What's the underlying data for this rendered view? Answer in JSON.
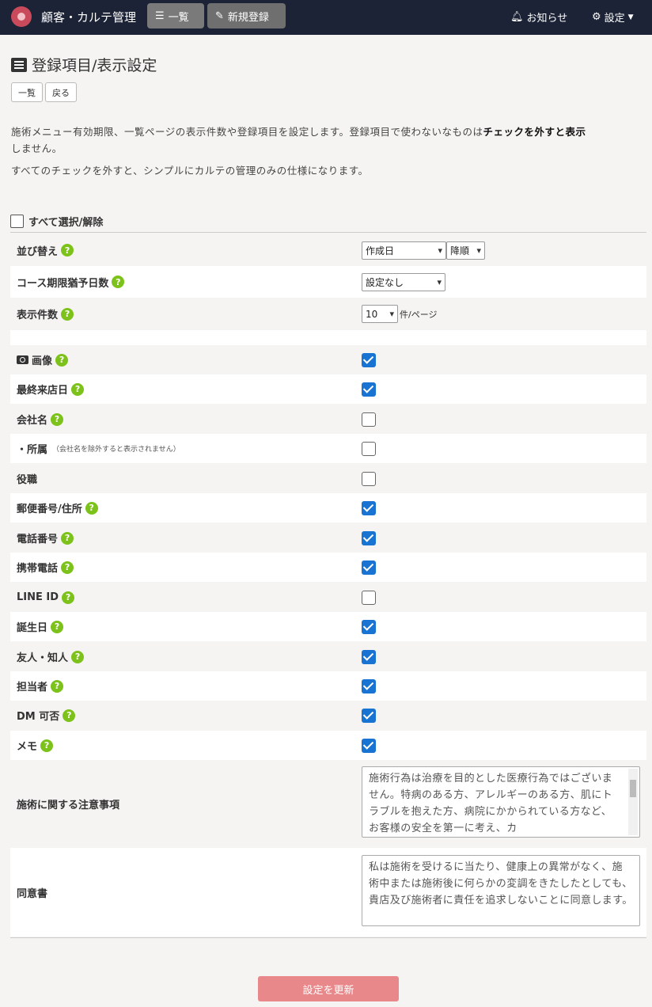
{
  "nav": {
    "brand": "顧客・カルテ管理",
    "list_label": "一覧",
    "new_label": "新規登録",
    "notice_label": "お知らせ",
    "settings_label": "設定"
  },
  "header": {
    "title": "登録項目/表示設定",
    "btn_list": "一覧",
    "btn_back": "戻る",
    "desc1_a": "施術メニュー有効期限、一覧ページの表示件数や登録項目を設定します。登録項目で使わないなものは",
    "desc1_bold": "チェックを外すと表示",
    "desc1_b": "しません。",
    "desc2": "すべてのチェックを外すと、シンプルにカルテの管理のみの仕様になります。"
  },
  "select_all_label": "すべて選択/解除",
  "settings": {
    "sort_label": "並び替え",
    "sort_by": "作成日",
    "sort_order": "降順",
    "grace_label": "コース期限猶予日数",
    "grace_value": "設定なし",
    "per_page_label": "表示件数",
    "per_page_value": "10",
    "per_page_suffix": "件/ページ"
  },
  "fields": [
    {
      "label": "画像",
      "checked": true,
      "help": true
    },
    {
      "label": "最終来店日",
      "checked": true,
      "help": true
    },
    {
      "label": "会社名",
      "checked": false,
      "help": true
    },
    {
      "label": "・所属",
      "note": "（会社名を除外すると表示されません）",
      "checked": false,
      "help": false
    },
    {
      "label": "役職",
      "checked": false,
      "help": false
    },
    {
      "label": "郵便番号/住所",
      "checked": true,
      "help": true
    },
    {
      "label": "電話番号",
      "checked": true,
      "help": true
    },
    {
      "label": "携帯電話",
      "checked": true,
      "help": true
    },
    {
      "label": "LINE ID",
      "checked": false,
      "help": true
    },
    {
      "label": "誕生日",
      "checked": true,
      "help": true
    },
    {
      "label": "友人・知人",
      "checked": true,
      "help": true
    },
    {
      "label": "担当者",
      "checked": true,
      "help": true
    },
    {
      "label": "DM 可否",
      "checked": true,
      "help": true
    },
    {
      "label": "メモ",
      "checked": true,
      "help": true
    }
  ],
  "notes": {
    "caution_label": "施術に関する注意事項",
    "caution_text": "施術行為は治療を目的とした医療行為ではございません。特病のある方、アレルギーのある方、肌にトラブルを抱えた方、病院にかかられている方など、お客様の安全を第一に考え、カ",
    "consent_label": "同意書",
    "consent_text": "私は施術を受けるに当たり、健康上の異常がなく、施術中または施術後に何らかの変調をきたしたとしても、貴店及び施術者に責任を追求しないことに同意します。"
  },
  "submit_label": "設定を更新",
  "colors": {
    "navbar": "#1c2336",
    "checkbox": "#1873d3",
    "help": "#7cc21a",
    "submit": "#e8888a"
  }
}
